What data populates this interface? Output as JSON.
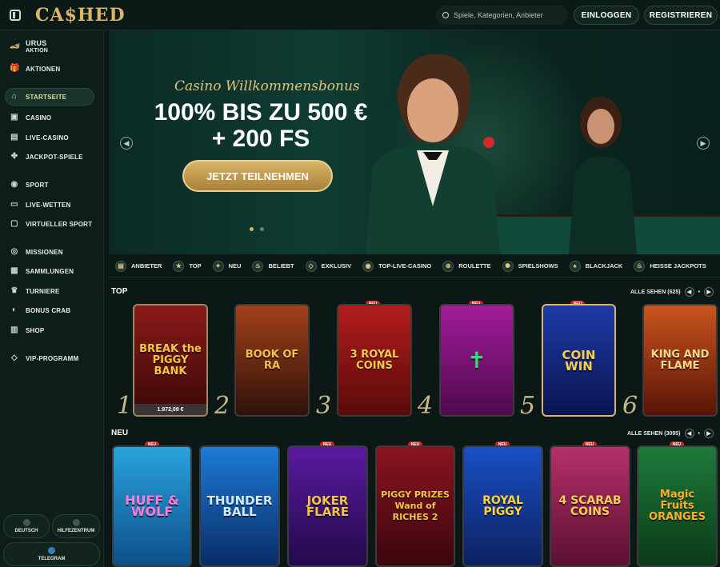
{
  "header": {
    "logo": "CA$HED",
    "search_placeholder": "Spiele, Kategorien, Anbieter",
    "login_label": "EINLOGGEN",
    "register_label": "REGISTRIEREN"
  },
  "sidebar": {
    "promo": {
      "title": "URUS",
      "subtitle": "AKTION"
    },
    "items": [
      {
        "label": "AKTIONEN",
        "icon": "gift-icon"
      },
      {
        "label": "STARTSEITE",
        "icon": "home-icon"
      },
      {
        "label": "CASINO",
        "icon": "casino-icon"
      },
      {
        "label": "LIVE-CASINO",
        "icon": "live-casino-icon"
      },
      {
        "label": "JACKPOT-SPIELE",
        "icon": "jackpot-icon"
      },
      {
        "label": "SPORT",
        "icon": "sport-icon"
      },
      {
        "label": "LIVE-WETTEN",
        "icon": "live-bet-icon"
      },
      {
        "label": "VIRTUELLER SPORT",
        "icon": "virtual-sport-icon"
      },
      {
        "label": "MISSIONEN",
        "icon": "missions-icon"
      },
      {
        "label": "SAMMLUNGEN",
        "icon": "collections-icon"
      },
      {
        "label": "TURNIERE",
        "icon": "trophy-icon"
      },
      {
        "label": "BONUS CRAB",
        "icon": "crab-icon"
      },
      {
        "label": "SHOP",
        "icon": "shop-icon"
      },
      {
        "label": "VIP-PROGRAMM",
        "icon": "diamond-icon"
      }
    ],
    "bottom": {
      "language": "DEUTSCH",
      "help": "HILFEZENTRUM",
      "telegram": "TELEGRAM"
    }
  },
  "hero": {
    "subtitle": "Casino Willkommensbonus",
    "title_line1": "100% BIS ZU 500 €",
    "title_line2": "+ 200 FS",
    "cta": "JETZT TEILNEHMEN"
  },
  "categories": [
    {
      "label": "ANBIETER",
      "icon": "provider-icon"
    },
    {
      "label": "TOP",
      "icon": "star-icon"
    },
    {
      "label": "NEU",
      "icon": "new-icon"
    },
    {
      "label": "BELIEBT",
      "icon": "flame-icon"
    },
    {
      "label": "EXKLUSIV",
      "icon": "diamond-icon"
    },
    {
      "label": "TOP-LIVE-CASINO",
      "icon": "live-icon"
    },
    {
      "label": "ROULETTE",
      "icon": "roulette-icon"
    },
    {
      "label": "SPIELSHOWS",
      "icon": "show-icon"
    },
    {
      "label": "BLACKJACK",
      "icon": "cards-icon"
    },
    {
      "label": "HEISSE JACKPOTS",
      "icon": "hot-jackpot-icon"
    }
  ],
  "top_section": {
    "title": "TOP",
    "see_all": "ALLE SEHEN (625)",
    "badge": "NEU",
    "games": [
      {
        "rank": "1",
        "title": "BREAK the PIGGY BANK",
        "jackpot": "1.972,09 €"
      },
      {
        "rank": "2",
        "title": "BOOK OF RA"
      },
      {
        "rank": "3",
        "title": "3 ROYAL COINS"
      },
      {
        "rank": "4",
        "title": "✝"
      },
      {
        "rank": "5",
        "title": "COIN WIN"
      },
      {
        "rank": "6",
        "title": "KING AND FLAME"
      }
    ]
  },
  "new_section": {
    "title": "NEU",
    "see_all": "ALLE SEHEN (3095)",
    "badge": "NEU",
    "games": [
      {
        "title": "HUFF & WOLF"
      },
      {
        "title": "THUNDER BALL"
      },
      {
        "title": "JOKER FLARE"
      },
      {
        "title": "PIGGY PRIZES Wand of RICHES 2"
      },
      {
        "title": "ROYAL PIGGY"
      },
      {
        "title": "4 SCARAB COINS"
      },
      {
        "title": "Magic Fruits ORANGES"
      }
    ]
  },
  "colors": {
    "accent": "#d9b56a",
    "background": "#0b1815",
    "badge": "#d62121"
  }
}
